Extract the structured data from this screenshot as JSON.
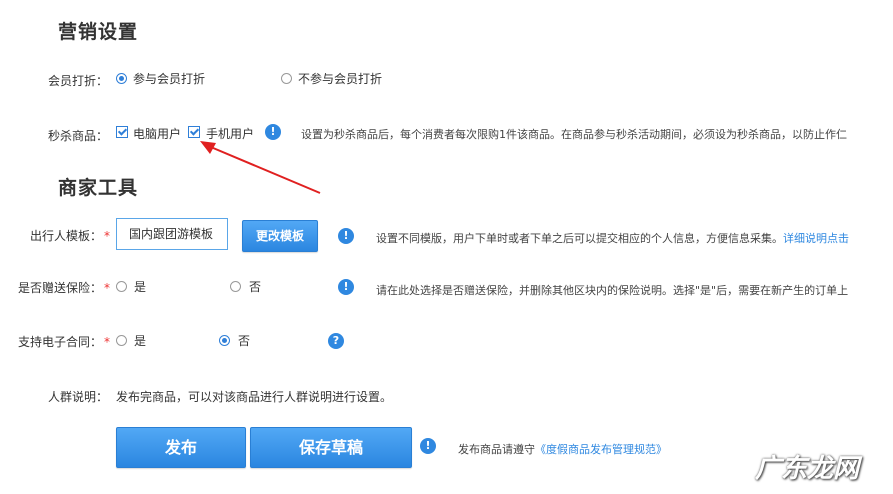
{
  "marketing": {
    "title": "营销设置",
    "member_discount": {
      "label": "会员打折：",
      "options": [
        "参与会员打折",
        "不参与会员打折"
      ],
      "selected": "参与会员打折"
    },
    "flash_sale": {
      "label": "秒杀商品：",
      "options": [
        "电脑用户",
        "手机用户"
      ],
      "checked": [
        "电脑用户",
        "手机用户"
      ],
      "hint": "设置为秒杀商品后，每个消费者每次限购1件该商品。在商品参与秒杀活动期间，必须设为秒杀商品，以防止作仁"
    }
  },
  "merchant_tools": {
    "title": "商家工具",
    "traveler_template": {
      "label": "出行人模板：",
      "required_mark": "*",
      "value": "国内跟团游模板",
      "change_button": "更改模板",
      "hint": "设置不同模版，用户下单时或者下单之后可以提交相应的个人信息，方便信息采集。",
      "hint_link": "详细说明点击"
    },
    "insurance": {
      "label": "是否赠送保险：",
      "required_mark": "*",
      "options": [
        "是",
        "否"
      ],
      "selected": "",
      "hint": "请在此处选择是否赠送保险，并删除其他区块内的保险说明。选择\"是\"后，需要在新产生的订单上"
    },
    "e_contract": {
      "label": "支持电子合同：",
      "required_mark": "*",
      "options": [
        "是",
        "否"
      ],
      "selected": "否"
    },
    "crowd": {
      "label": "人群说明：",
      "text": "发布完商品，可以对该商品进行人群说明进行设置。"
    }
  },
  "footer": {
    "publish_button": "发布",
    "save_draft_button": "保存草稿",
    "notice_prefix": "发布商品请遵守",
    "notice_link": "《度假商品发布管理规范》"
  },
  "watermark": "广东龙网",
  "colors": {
    "accent": "#2f88e0",
    "button": "#3b95ea",
    "arrow": "#e02020",
    "required": "#ee3333"
  }
}
